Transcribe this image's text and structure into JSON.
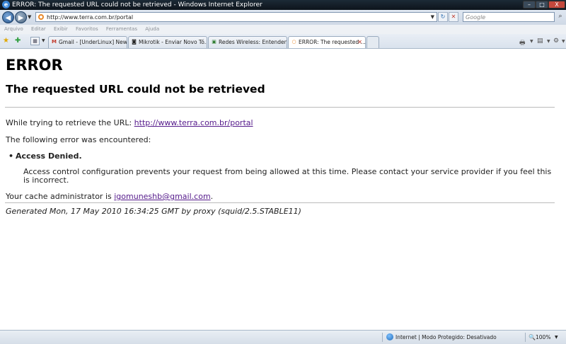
{
  "window": {
    "title": "ERROR: The requested URL could not be retrieved - Windows Internet Explorer",
    "minimize": "–",
    "maximize": "□",
    "close": "X"
  },
  "address_bar": {
    "url": "http://www.terra.com.br/portal",
    "search_placeholder": "Google"
  },
  "menu": [
    "Arquivo",
    "Editar",
    "Exibir",
    "Favoritos",
    "Ferramentas",
    "Ajuda"
  ],
  "tabs": [
    {
      "label": "Gmail - [UnderLinux] New...",
      "icon": "M"
    },
    {
      "label": "Mikrotik - Enviar Novo Tó...",
      "icon": "◙"
    },
    {
      "label": "Redes Wireless: Entendend...",
      "icon": "▣"
    },
    {
      "label": "ERROR: The requested ...",
      "icon": "○",
      "active": true
    }
  ],
  "page": {
    "heading": "ERROR",
    "subheading": "The requested URL could not be retrieved",
    "retrieve_prefix": "While trying to retrieve the URL: ",
    "retrieve_url": "http://www.terra.com.br/portal",
    "error_intro": "The following error was encountered:",
    "error_name": "Access Denied.",
    "error_description": "Access control configuration prevents your request from being allowed at this time. Please contact your service provider if you feel this is incorrect.",
    "admin_prefix": "Your cache administrator is ",
    "admin_email": "igomuneshb@gmail.com",
    "admin_suffix": ".",
    "generated": "Generated Mon, 17 May 2010 16:34:25 GMT by proxy (squid/2.5.STABLE11)"
  },
  "status_bar": {
    "zone": "Internet | Modo Protegido: Desativado",
    "zoom": "100%"
  },
  "colors": {
    "link_visited": "#551a8b",
    "titlebar": "#0d141b"
  }
}
